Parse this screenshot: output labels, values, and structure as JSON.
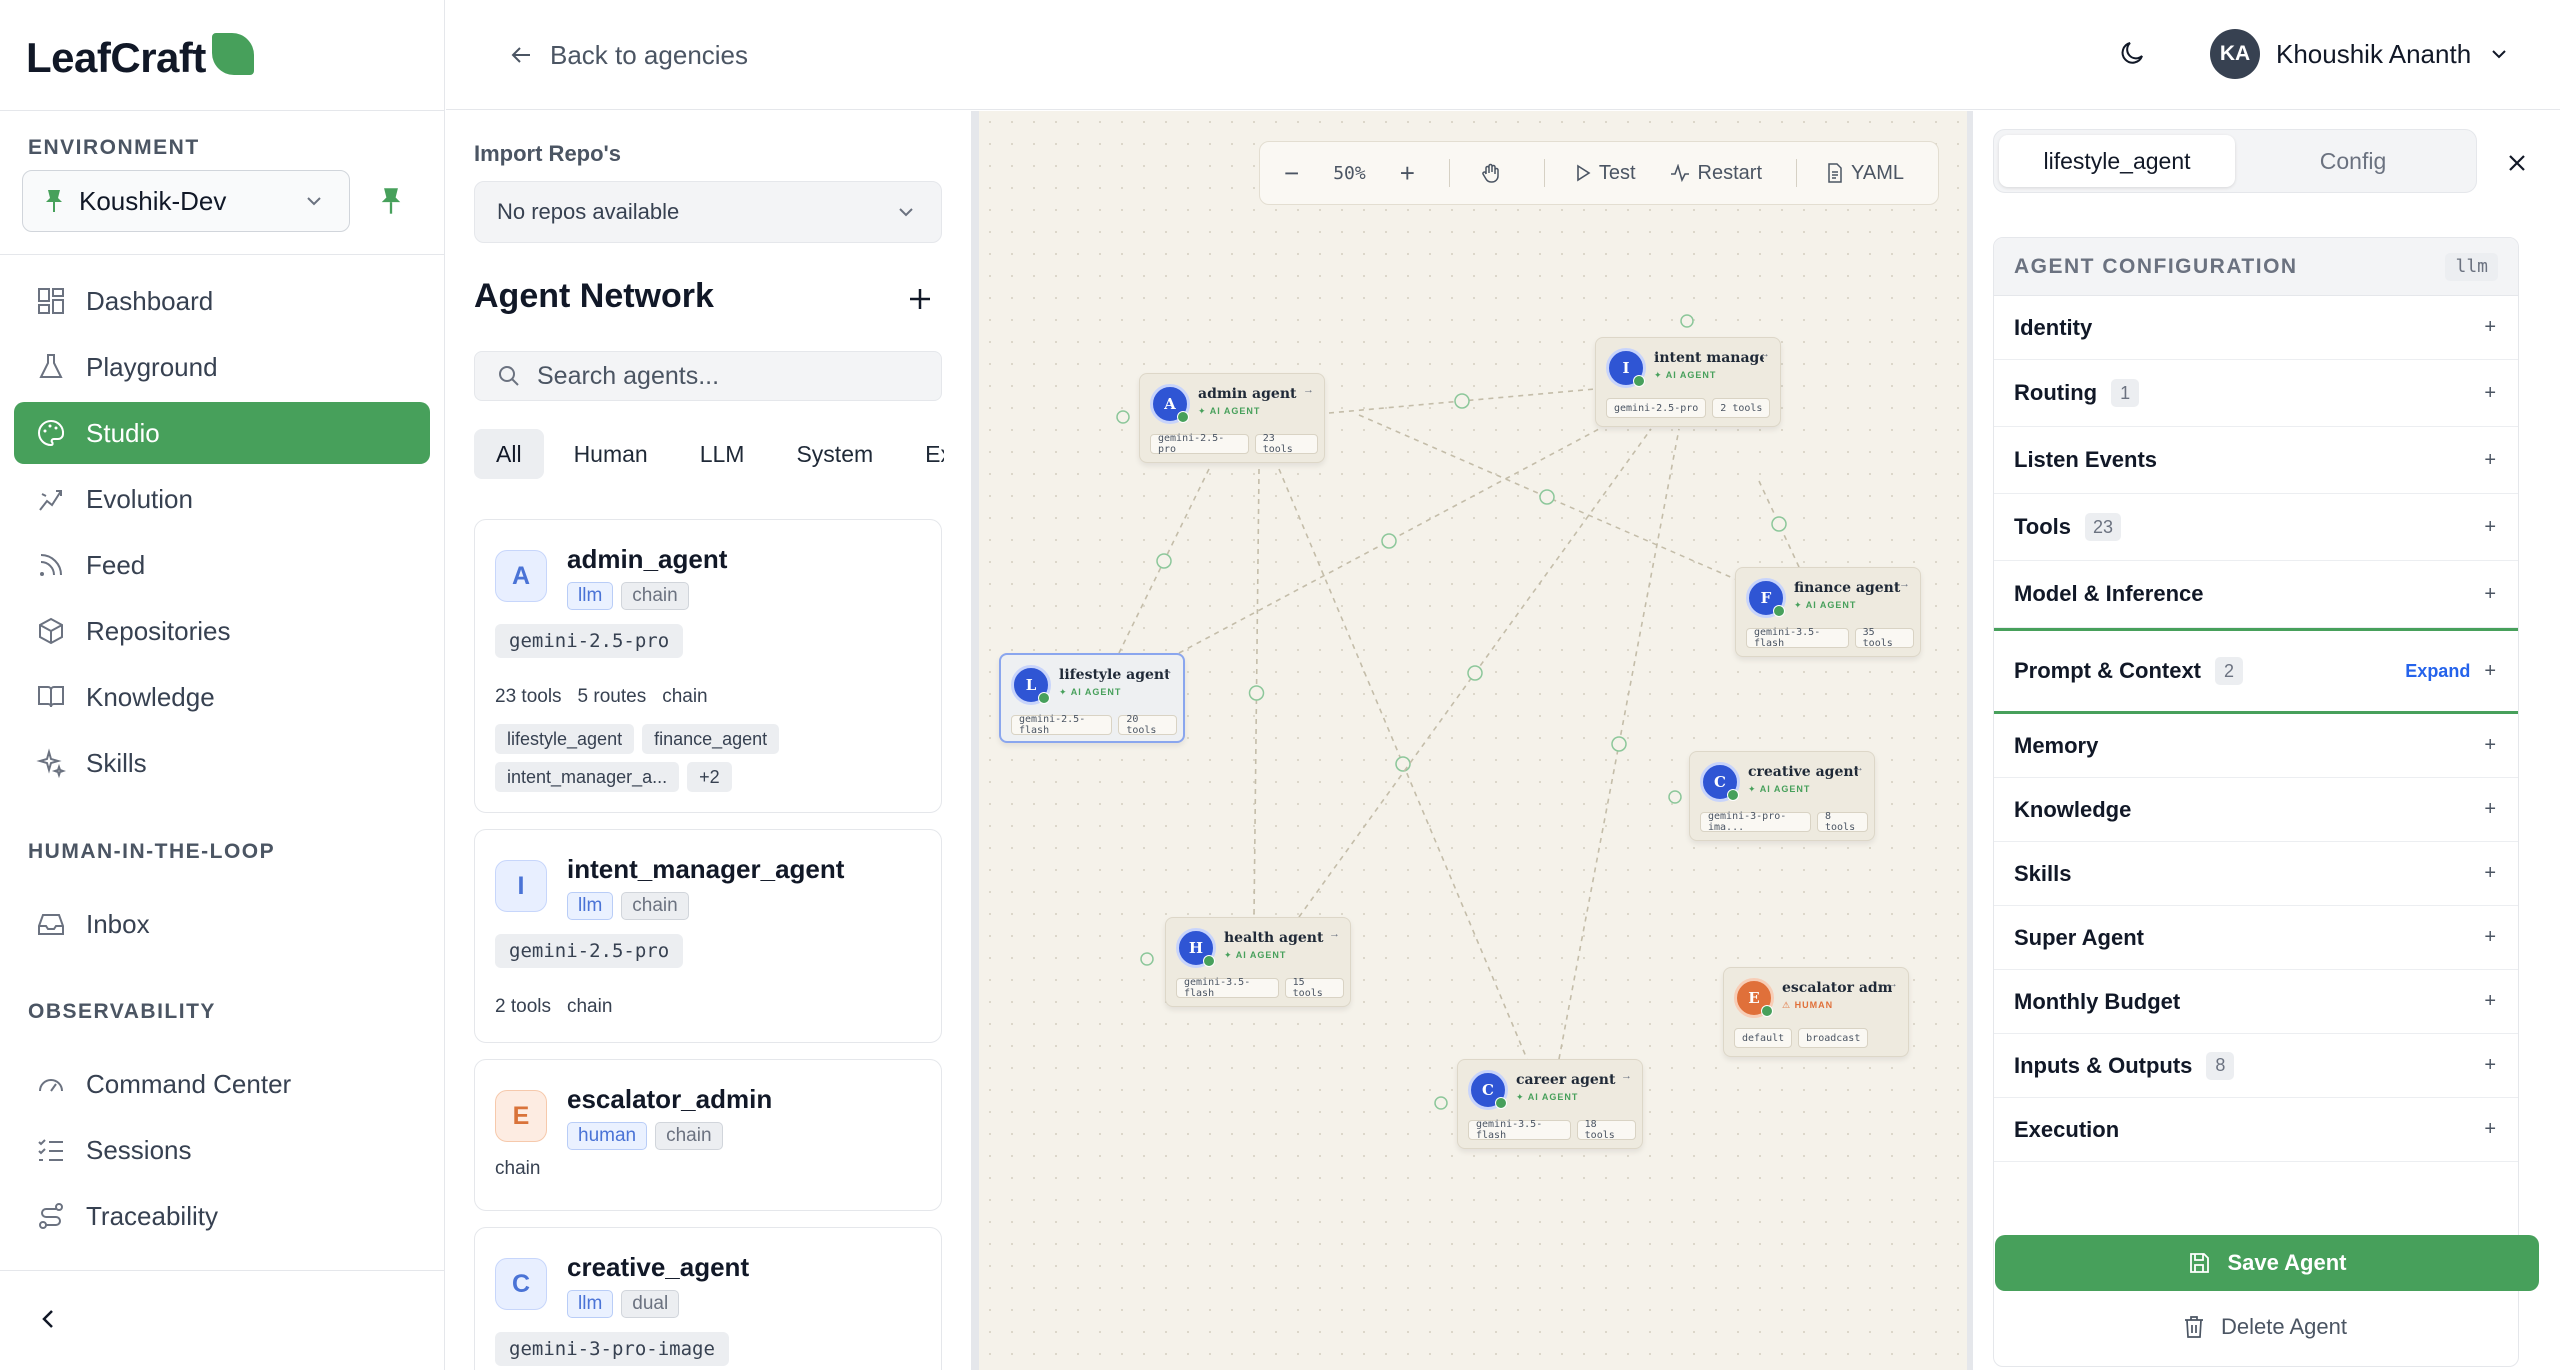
{
  "brand": {
    "name": "LeafCraft"
  },
  "sidebar": {
    "environment_label": "ENVIRONMENT",
    "environment_value": "Koushik-Dev",
    "nav": [
      {
        "label": "Dashboard",
        "icon": "dashboard-icon"
      },
      {
        "label": "Playground",
        "icon": "flask-icon"
      },
      {
        "label": "Studio",
        "icon": "palette-icon",
        "active": true
      },
      {
        "label": "Evolution",
        "icon": "evolution-icon"
      },
      {
        "label": "Feed",
        "icon": "rss-icon"
      },
      {
        "label": "Repositories",
        "icon": "package-icon"
      },
      {
        "label": "Knowledge",
        "icon": "book-icon"
      },
      {
        "label": "Skills",
        "icon": "sparkles-icon"
      }
    ],
    "hitl_label": "HUMAN-IN-THE-LOOP",
    "hitl_nav": [
      {
        "label": "Inbox",
        "icon": "inbox-icon"
      }
    ],
    "observability_label": "OBSERVABILITY",
    "observability_nav": [
      {
        "label": "Command Center",
        "icon": "gauge-icon"
      },
      {
        "label": "Sessions",
        "icon": "list-checks-icon"
      },
      {
        "label": "Traceability",
        "icon": "route-icon"
      }
    ]
  },
  "topbar": {
    "back_label": "Back to agencies",
    "user": {
      "initials": "KA",
      "name": "Khoushik Ananth"
    }
  },
  "list_panel": {
    "import_label": "Import Repo's",
    "repo_value": "No repos available",
    "title": "Agent Network",
    "search_placeholder": "Search agents...",
    "filters": [
      "All",
      "Human",
      "LLM",
      "System",
      "Exte"
    ],
    "agents": [
      {
        "initial": "A",
        "name": "admin_agent",
        "tags": [
          "llm",
          "chain"
        ],
        "model": "gemini-2.5-pro",
        "tools": "23 tools",
        "routes_count": "5 routes",
        "mode": "chain",
        "routes": [
          "lifestyle_agent",
          "finance_agent",
          "intent_manager_a...",
          "+2"
        ]
      },
      {
        "initial": "I",
        "name": "intent_manager_agent",
        "tags": [
          "llm",
          "chain"
        ],
        "model": "gemini-2.5-pro",
        "tools": "2 tools",
        "mode": "chain"
      },
      {
        "initial": "E",
        "name": "escalator_admin",
        "tags": [
          "human",
          "chain"
        ],
        "mode": "chain"
      },
      {
        "initial": "C",
        "name": "creative_agent",
        "tags": [
          "llm",
          "dual"
        ],
        "model": "gemini-3-pro-image"
      }
    ]
  },
  "canvas": {
    "toolbar": {
      "zoom_out": "−",
      "zoom": "50%",
      "zoom_in": "+",
      "test": "Test",
      "restart": "Restart",
      "yaml": "YAML"
    },
    "nodes": [
      {
        "id": "admin",
        "initial": "A",
        "name": "admin agent",
        "type": "AI AGENT",
        "chips": [
          "gemini-2.5-pro",
          "23 tools"
        ]
      },
      {
        "id": "intent",
        "initial": "I",
        "name": "intent manage...",
        "type": "AI AGENT",
        "chips": [
          "gemini-2.5-pro",
          "2 tools"
        ]
      },
      {
        "id": "finance",
        "initial": "F",
        "name": "finance agent",
        "type": "AI AGENT",
        "chips": [
          "gemini-3.5-flash",
          "35 tools"
        ]
      },
      {
        "id": "lifestyle",
        "initial": "L",
        "name": "lifestyle agent",
        "type": "AI AGENT",
        "chips": [
          "gemini-2.5-flash",
          "20 tools"
        ]
      },
      {
        "id": "creative",
        "initial": "C",
        "name": "creative agent",
        "type": "AI AGENT",
        "chips": [
          "gemini-3-pro-ima...",
          "8 tools"
        ]
      },
      {
        "id": "health",
        "initial": "H",
        "name": "health agent",
        "type": "AI AGENT",
        "chips": [
          "gemini-3.5-flash",
          "15 tools"
        ]
      },
      {
        "id": "escalator",
        "initial": "E",
        "name": "escalator admin",
        "type": "HUMAN",
        "chips": [
          "default",
          "broadcast"
        ]
      },
      {
        "id": "career",
        "initial": "C",
        "name": "career agent",
        "type": "AI AGENT",
        "chips": [
          "gemini-3.5-flash",
          "18 tools"
        ]
      }
    ]
  },
  "config_panel": {
    "tabs": [
      "lifestyle_agent",
      "Config"
    ],
    "section_title": "AGENT CONFIGURATION",
    "section_badge": "llm",
    "rows": [
      {
        "label": "Identity"
      },
      {
        "label": "Routing",
        "count": "1"
      },
      {
        "label": "Listen Events"
      },
      {
        "label": "Tools",
        "count": "23"
      },
      {
        "label": "Model & Inference"
      },
      {
        "label": "Prompt & Context",
        "count": "2",
        "expand": "Expand"
      },
      {
        "label": "Memory"
      },
      {
        "label": "Knowledge"
      },
      {
        "label": "Skills"
      },
      {
        "label": "Super Agent"
      },
      {
        "label": "Monthly Budget"
      },
      {
        "label": "Inputs & Outputs",
        "count": "8"
      },
      {
        "label": "Execution"
      }
    ],
    "plus": "+",
    "save_label": "Save Agent",
    "delete_label": "Delete Agent"
  },
  "colors": {
    "accent": "#47a05b",
    "node_blue": "#2f55d4",
    "node_orange": "#e0703a",
    "canvas_bg": "#f5f2ea"
  }
}
